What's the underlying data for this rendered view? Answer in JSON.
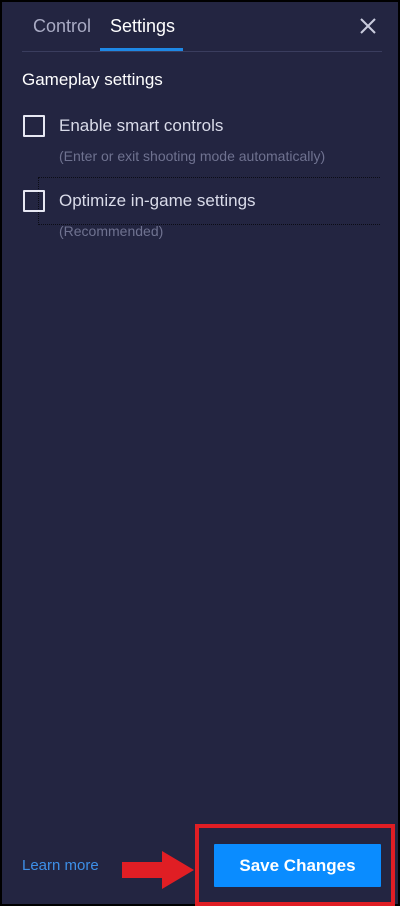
{
  "tabs": [
    {
      "label": "Control",
      "active": false
    },
    {
      "label": "Settings",
      "active": true
    }
  ],
  "close_icon": "close-icon",
  "section_title": "Gameplay settings",
  "options": [
    {
      "label": "Enable smart controls",
      "description": "(Enter or exit shooting mode automatically)",
      "checked": false
    },
    {
      "label": "Optimize in-game settings",
      "description": "(Recommended)",
      "checked": false
    }
  ],
  "footer": {
    "learn_more": "Learn more",
    "save_button": "Save Changes"
  },
  "colors": {
    "panel_bg": "#232541",
    "accent": "#0a8cff",
    "link": "#3d8fe8",
    "annotation": "#e01e24"
  }
}
